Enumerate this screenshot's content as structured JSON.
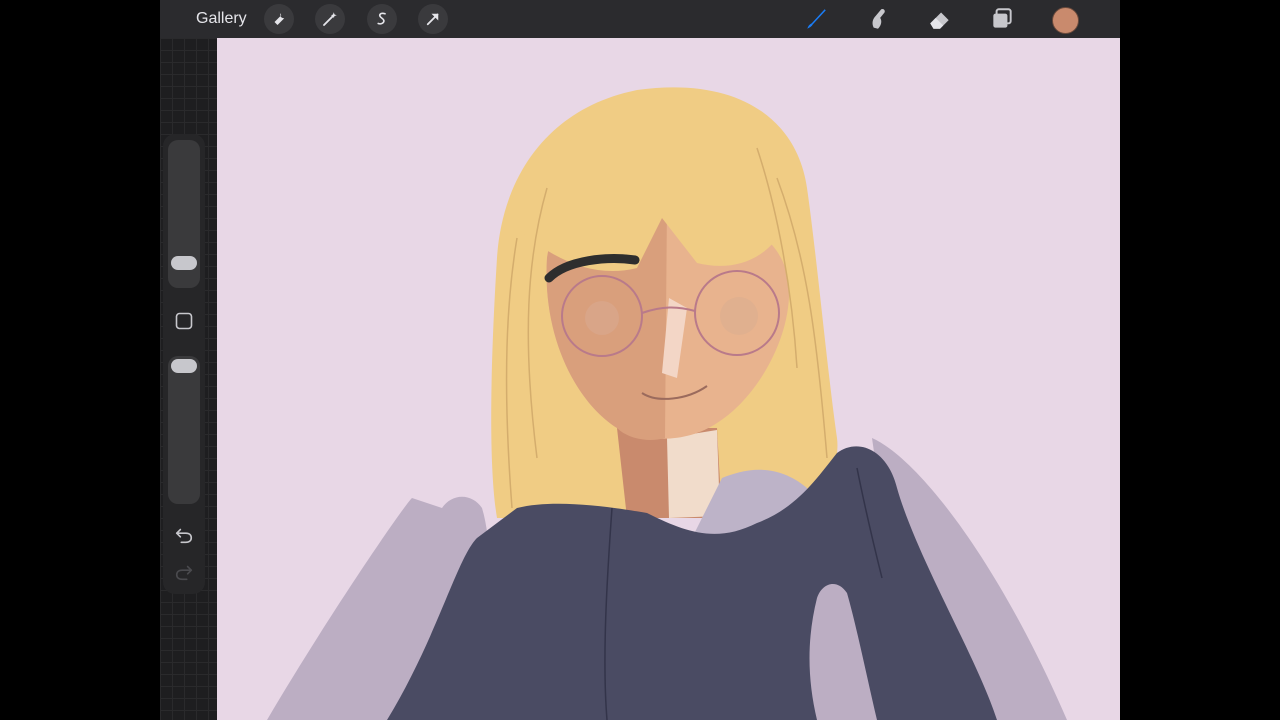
{
  "topbar": {
    "gallery_label": "Gallery",
    "left_tools": [
      {
        "icon": "wrench-icon",
        "name": "actions"
      },
      {
        "icon": "magic-wand-icon",
        "name": "adjustments"
      },
      {
        "icon": "selection-icon",
        "name": "selection"
      },
      {
        "icon": "transform-arrow-icon",
        "name": "transform"
      }
    ],
    "right_tools": [
      {
        "icon": "brush-icon",
        "name": "brush",
        "active": true
      },
      {
        "icon": "smudge-icon",
        "name": "smudge",
        "active": false
      },
      {
        "icon": "eraser-icon",
        "name": "eraser",
        "active": false
      },
      {
        "icon": "layers-icon",
        "name": "layers",
        "active": false
      }
    ],
    "current_color": "#c98a6d",
    "active_tool_color": "#1a7cf5"
  },
  "sidebar": {
    "brush_size_level": 0.18,
    "opacity_level": 0.95,
    "modify_icon": "square-icon",
    "undo_icon": "undo-icon",
    "redo_icon": "redo-icon"
  },
  "canvas": {
    "background_color": "#e8d7e6"
  }
}
